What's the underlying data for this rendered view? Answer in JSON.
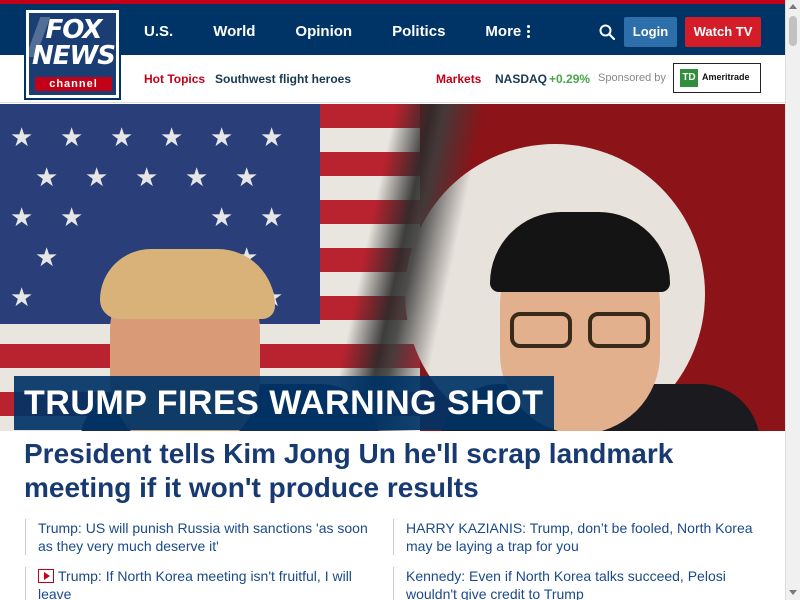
{
  "logo": {
    "line1": "FOX",
    "line2": "NEWS",
    "line3": "channel"
  },
  "nav": {
    "items": [
      {
        "label": "U.S."
      },
      {
        "label": "World"
      },
      {
        "label": "Opinion"
      },
      {
        "label": "Politics"
      },
      {
        "label": "More"
      }
    ],
    "login_label": "Login",
    "watch_label": "Watch TV"
  },
  "subbar": {
    "hot_topics": "Hot Topics",
    "hot_link": "Southwest flight heroes",
    "markets": "Markets",
    "nasdaq_label": "NASDAQ",
    "nasdaq_change": "+0.29%",
    "sponsored": "Sponsored by",
    "sponsor_mark": "TD",
    "sponsor_name": "Ameritrade"
  },
  "hero": {
    "banner": "TRUMP FIRES WARNING SHOT",
    "headline": "President tells Kim Jong Un he'll scrap landmark meeting if it won't produce results"
  },
  "related": [
    {
      "text": "Trump: US will punish Russia with sanctions 'as soon as they very much deserve it'",
      "video": false
    },
    {
      "text": "HARRY KAZIANIS: Trump, don’t be fooled, North Korea may be laying a trap for you",
      "video": false
    },
    {
      "text": "Trump: If North Korea meeting isn't fruitful, I will leave",
      "video": true
    },
    {
      "text": "Kennedy: Even if North Korea talks succeed, Pelosi wouldn't give credit to Trump",
      "video": false
    }
  ],
  "colors": {
    "nav_bg": "#003366",
    "accent_red": "#c20017",
    "login_blue": "#2c6fab",
    "watch_red": "#d51d29",
    "headline_blue": "#183a73",
    "nasdaq_green": "#4aa54a"
  }
}
